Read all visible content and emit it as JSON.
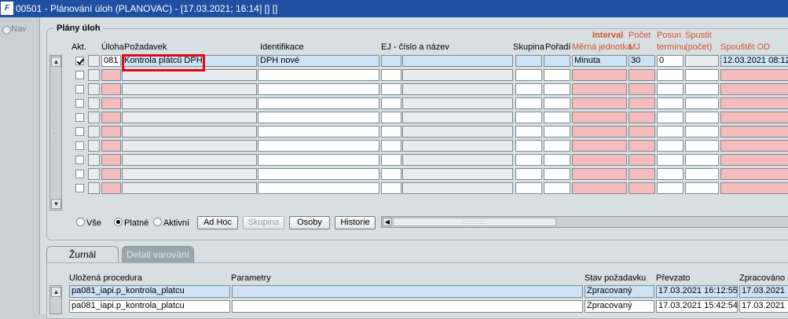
{
  "window": {
    "title": "00501 - Plánování úloh (PLANOVAC) - [17.03.2021; 16:14] [] []",
    "logo": "F"
  },
  "nav": {
    "label": "Nav"
  },
  "plans": {
    "section_title": "Plány úloh",
    "headers": {
      "akt": "Akt.",
      "uloha": "Úloha",
      "pozadavek": "Požadavek",
      "identifikace": "Identifikace",
      "ej": "EJ - číslo a název",
      "skupina": "Skupina",
      "poradi": "Pořadí",
      "interval": "Interval",
      "merna": "Měrná jednotka",
      "pocet_mj_1": "Počet",
      "pocet_mj_2": "MJ",
      "posun_1": "Posun",
      "posun_2": "termínu",
      "spustit_1": "Spustit",
      "spustit_2": "(počet)",
      "spoustet": "Spouštět OD"
    },
    "rows": [
      {
        "checked": true,
        "uloha": "081",
        "pozadavek": "Kontrola plátců DPH",
        "identifikace": "DPH nové",
        "merna": "Minuta",
        "pocet": "30",
        "posun": "0",
        "spoustet": "12.03.2021 08:12"
      }
    ],
    "empty_rows": 9
  },
  "filters": {
    "vse": "Vše",
    "platne": "Platné",
    "aktivni": "Aktivní",
    "selected": "Platné"
  },
  "buttons": {
    "adhoc": "Ad Hoc",
    "skupina": "Skupina",
    "osoby": "Osoby",
    "historie": "Historie"
  },
  "tabs": {
    "zurnal": "Žurnál",
    "detail": "Detail varování"
  },
  "journal": {
    "headers": {
      "procedura": "Uložená procedura",
      "parametry": "Parametry",
      "stav": "Stav požadavku",
      "prevzato": "Převzato",
      "zpracovano": "Zpracováno"
    },
    "rows": [
      {
        "procedura": "pa081_iapi.p_kontrola_platcu",
        "parametry": "",
        "stav": "Zpracovaný",
        "prevzato": "17.03.2021 16:12:55",
        "zpracovano": "17.03.2021 16:13"
      },
      {
        "procedura": "pa081_iapi.p_kontrola_platcu",
        "parametry": "",
        "stav": "Zpracovaný",
        "prevzato": "17.03.2021 15:42:54",
        "zpracovano": "17.03.2021 15:43"
      }
    ]
  },
  "colors": {
    "title_bar": "#1e4fa0",
    "pink_cell": "#f4bcbc",
    "blue_cell": "#cde3f5",
    "orange_header": "#d2542c",
    "highlight_box": "#e30613"
  }
}
